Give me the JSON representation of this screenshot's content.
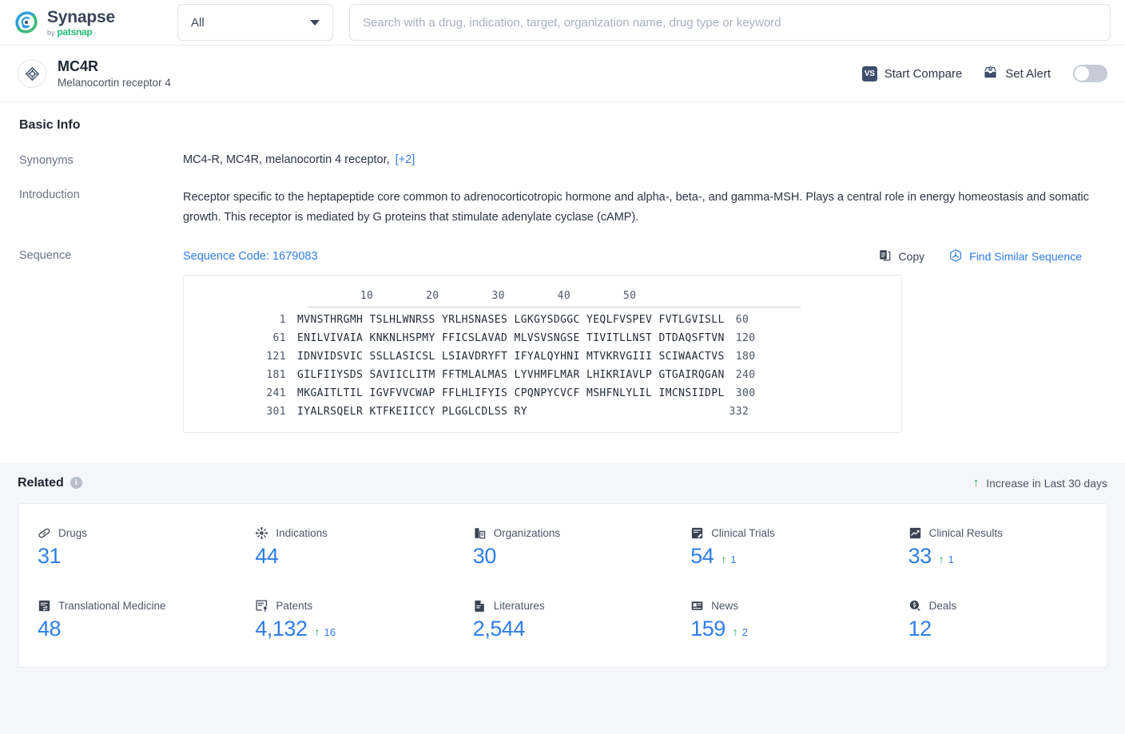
{
  "brand": {
    "name": "Synapse",
    "by": "by",
    "company": "patsnap",
    "logo_icon": "synapse-swirl-logo"
  },
  "search": {
    "scope_value": "All",
    "scope_caret_icon": "chevron-down-icon",
    "placeholder": "Search with a drug, indication, target, organization name, drug type or keyword",
    "value": ""
  },
  "entity": {
    "icon": "target-crosshair-icon",
    "title": "MC4R",
    "subtitle": "Melanocortin receptor 4",
    "actions": {
      "compare_badge": "VS",
      "compare_label": "Start Compare",
      "alert_icon": "alert-inbox-icon",
      "alert_label": "Set Alert",
      "alert_toggle_state": "off"
    }
  },
  "basic_info": {
    "heading": "Basic Info",
    "synonyms_label": "Synonyms",
    "synonyms_value": "MC4-R,  MC4R,  melanocortin 4 receptor,",
    "synonyms_more": "[+2]",
    "introduction_label": "Introduction",
    "introduction_value": "Receptor specific to the heptapeptide core common to adrenocorticotropic hormone and alpha-, beta-, and gamma-MSH. Plays a central role in energy homeostasis and somatic growth. This receptor is mediated by G proteins that stimulate adenylate cyclase (cAMP).",
    "sequence_label": "Sequence",
    "sequence_code": "Sequence Code: 1679083",
    "copy_icon": "copy-icon",
    "copy_label": "Copy",
    "find_similar_icon": "similar-sequence-icon",
    "find_similar_label": "Find Similar Sequence"
  },
  "sequence": {
    "ruler": "        10        20        30        40        50",
    "total_length": "332",
    "rows": [
      {
        "start": "1",
        "blocks": "MVNSTHRGMH TSLHLWNRSS YRLHSNASES LGKGYSDGGC YEQLFVSPEV FVTLGVISLL",
        "end": "60"
      },
      {
        "start": "61",
        "blocks": "ENILVIVAIA KNKNLHSPMY FFICSLAVAD MLVSVSNGSE TIVITLLNST DTDAQSFTVN",
        "end": "120"
      },
      {
        "start": "121",
        "blocks": "IDNVIDSVIC SSLLASICSL LSIAVDRYFT IFYALQYHNI MTVKRVGIII SCIWAACTVS",
        "end": "180"
      },
      {
        "start": "181",
        "blocks": "GILFIIYSDS SAVIICLITM FFTMLALMAS LYVHMFLMAR LHIKRIAVLP GTGAIRQGAN",
        "end": "240"
      },
      {
        "start": "241",
        "blocks": "MKGAITLTIL IGVFVVCWAP FFLHLIFYIS CPQNPYCVCF MSHFNLYLIL IMCNSIIDPL",
        "end": "300"
      },
      {
        "start": "301",
        "blocks": "IYALRSQELR KTFKEIICCY PLGGLCDLSS RY                             ",
        "end": "332"
      }
    ]
  },
  "related": {
    "heading": "Related",
    "info_icon": "info-icon",
    "increase_arrow_icon": "arrow-up-icon",
    "increase_label": "Increase in Last 30 days",
    "stats": [
      {
        "icon": "pill-icon",
        "label": "Drugs",
        "value": "31",
        "delta": ""
      },
      {
        "icon": "virus-icon",
        "label": "Indications",
        "value": "44",
        "delta": ""
      },
      {
        "icon": "organization-icon",
        "label": "Organizations",
        "value": "30",
        "delta": ""
      },
      {
        "icon": "clinical-trial-icon",
        "label": "Clinical Trials",
        "value": "54",
        "delta": "1"
      },
      {
        "icon": "clinical-result-icon",
        "label": "Clinical Results",
        "value": "33",
        "delta": "1"
      },
      {
        "icon": "translational-icon",
        "label": "Translational Medicine",
        "value": "48",
        "delta": ""
      },
      {
        "icon": "patent-icon",
        "label": "Patents",
        "value": "4,132",
        "delta": "16"
      },
      {
        "icon": "literature-icon",
        "label": "Literatures",
        "value": "2,544",
        "delta": ""
      },
      {
        "icon": "news-icon",
        "label": "News",
        "value": "159",
        "delta": "2"
      },
      {
        "icon": "deal-icon",
        "label": "Deals",
        "value": "12",
        "delta": ""
      }
    ]
  },
  "colors": {
    "accent_blue": "#2f7ee8",
    "green": "#2aa14f",
    "logo_blue": "#2e9fd6",
    "logo_green": "#3bb878",
    "navy": "#3f4e6b"
  }
}
